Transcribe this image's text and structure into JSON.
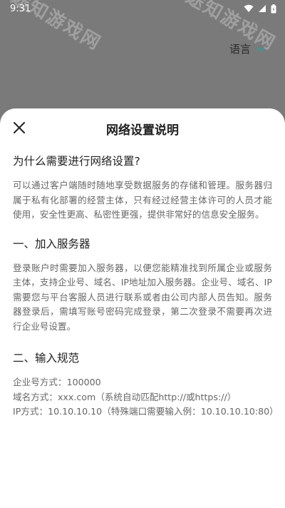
{
  "status_bar": {
    "time": "9:31"
  },
  "watermark": {
    "text": "途知游戏网"
  },
  "language": {
    "label": "语言"
  },
  "sheet": {
    "title": "网络设置说明",
    "question": "为什么需要进行网络设置?",
    "intro": "可以通过客户端随时随地享受数据服务的存储和管理。服务器归属于私有化部署的经营主体，只有经过经营主体许可的人员才能使用，安全性更高、私密性更强，提供非常好的信息安全服务。",
    "section1": {
      "title": "一、加入服务器",
      "body": "登录账户时需要加入服务器，以便您能精准找到所属企业或服务主体，支持企业号、域名、IP地址加入服务器。企业号、域名、IP需要您与平台客服人员进行联系或者由公司内部人员告知。服务器登录后，需填写账号密码完成登录，第二次登录不需要再次进行企业号设置。"
    },
    "section2": {
      "title": "二、输入规范",
      "rules": [
        "企业号方式：100000",
        "域名方式：xxx.com（系统自动匹配http://或https://）",
        "IP方式：10.10.10.10（特殊端口需要输入例：10.10.10.10:80）"
      ]
    }
  }
}
